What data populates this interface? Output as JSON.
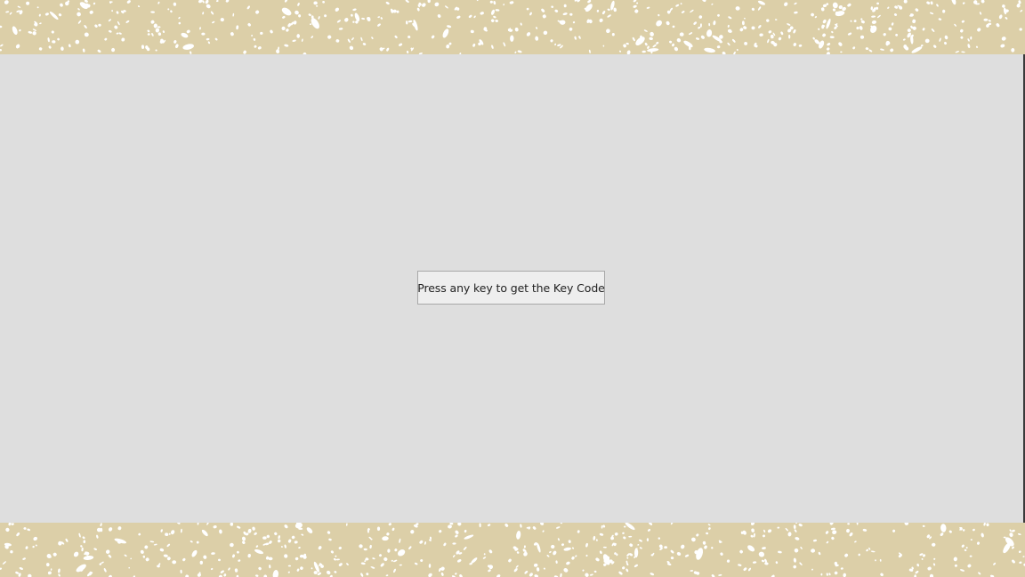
{
  "background": {
    "pattern_name": "white-speckle-pattern",
    "pattern_color": "#dccfa8",
    "speck_color": "#ffffff"
  },
  "stage": {
    "color": "#dedede"
  },
  "prompt": {
    "text": "Press any key to get the Key Code"
  }
}
